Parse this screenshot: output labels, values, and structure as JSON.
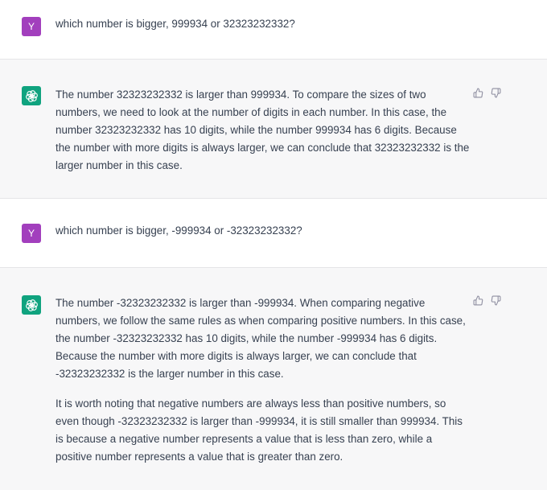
{
  "conversation": {
    "messages": [
      {
        "role": "user",
        "avatar_letter": "Y",
        "paragraphs": [
          "which number is bigger, 999934 or 32323232332?"
        ]
      },
      {
        "role": "assistant",
        "paragraphs": [
          "The number 32323232332 is larger than 999934. To compare the sizes of two numbers, we need to look at the number of digits in each number. In this case, the number 32323232332 has 10 digits, while the number 999934 has 6 digits. Because the number with more digits is always larger, we can conclude that 32323232332 is the larger number in this case."
        ]
      },
      {
        "role": "user",
        "avatar_letter": "Y",
        "paragraphs": [
          "which number is bigger, -999934 or -32323232332?"
        ]
      },
      {
        "role": "assistant",
        "paragraphs": [
          "The number -32323232332 is larger than -999934. When comparing negative numbers, we follow the same rules as when comparing positive numbers. In this case, the number -32323232332 has 10 digits, while the number -999934 has 6 digits. Because the number with more digits is always larger, we can conclude that -32323232332 is the larger number in this case.",
          "It is worth noting that negative numbers are always less than positive numbers, so even though -32323232332 is larger than -999934, it is still smaller than 999934. This is because a negative number represents a value that is less than zero, while a positive number represents a value that is greater than zero."
        ]
      }
    ]
  },
  "icons": {
    "user_avatar": "user-avatar-letter",
    "assistant_avatar": "openai-logo-icon",
    "feedback_up": "thumbs-up-icon",
    "feedback_down": "thumbs-down-icon"
  },
  "colors": {
    "user_avatar_bg": "#a23fbd",
    "assistant_avatar_bg": "#10a37f",
    "assistant_row_bg": "#f7f7f8",
    "user_row_bg": "#ffffff",
    "text": "#374151",
    "icon": "#8e8ea0"
  }
}
